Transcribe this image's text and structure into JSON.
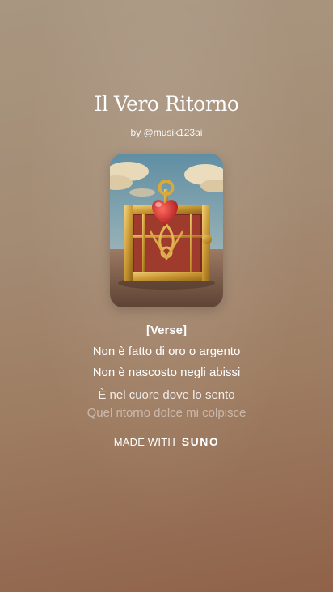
{
  "song": {
    "title": "Il Vero Ritorno",
    "byline": "by @musik123ai"
  },
  "cover_art": {
    "icon": "treasure-chest-heart-image",
    "colors": {
      "sky": "#6f98a8",
      "ground": "#7a5a48",
      "chest_gold": "#d1a341",
      "chest_red": "#8e2f24",
      "heart": "#d32b2b"
    }
  },
  "lyrics": {
    "section": "[Verse]",
    "lines": [
      "Non è fatto di oro o argento",
      "Non è nascosto negli abissi",
      "È nel cuore dove lo sento",
      "Quel ritorno dolce mi colpisce"
    ]
  },
  "footer": {
    "made_with": "MADE WITH",
    "brand": "SUNO"
  }
}
